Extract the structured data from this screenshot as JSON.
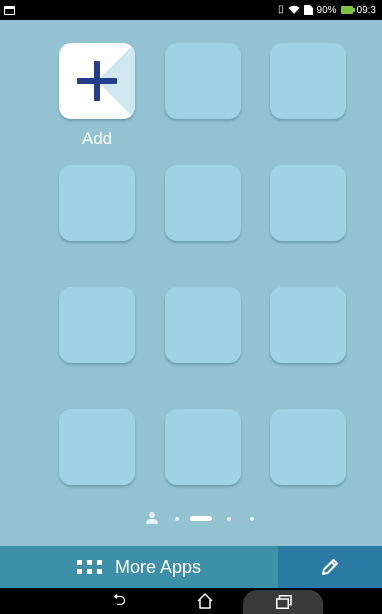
{
  "status_bar": {
    "battery_percent": "90%",
    "time": "09:3",
    "icons": [
      "notification-icon",
      "vibrate-icon",
      "wifi-icon",
      "sim-icon",
      "battery-icon"
    ]
  },
  "home": {
    "add_tile": {
      "label": "Add",
      "icon": "plus-icon"
    },
    "empty_tile_count": 11
  },
  "pager": {
    "pages": [
      "person-page",
      "page-1",
      "page-2",
      "page-3",
      "page-4"
    ],
    "current_page_index": 2
  },
  "bottom_bar": {
    "more_apps_label": "More Apps",
    "more_apps_icon": "grid-icon",
    "edit_icon": "pencil-icon"
  },
  "nav_bar": {
    "buttons": [
      "back-icon",
      "home-icon",
      "recent-apps-icon"
    ]
  },
  "colors": {
    "wallpaper": "#93c3d0",
    "tile": "#9fd3e4",
    "plus": "#233e8b",
    "more_apps_bar": "#3e8fa8",
    "edit_bar": "#2a7aa3"
  }
}
